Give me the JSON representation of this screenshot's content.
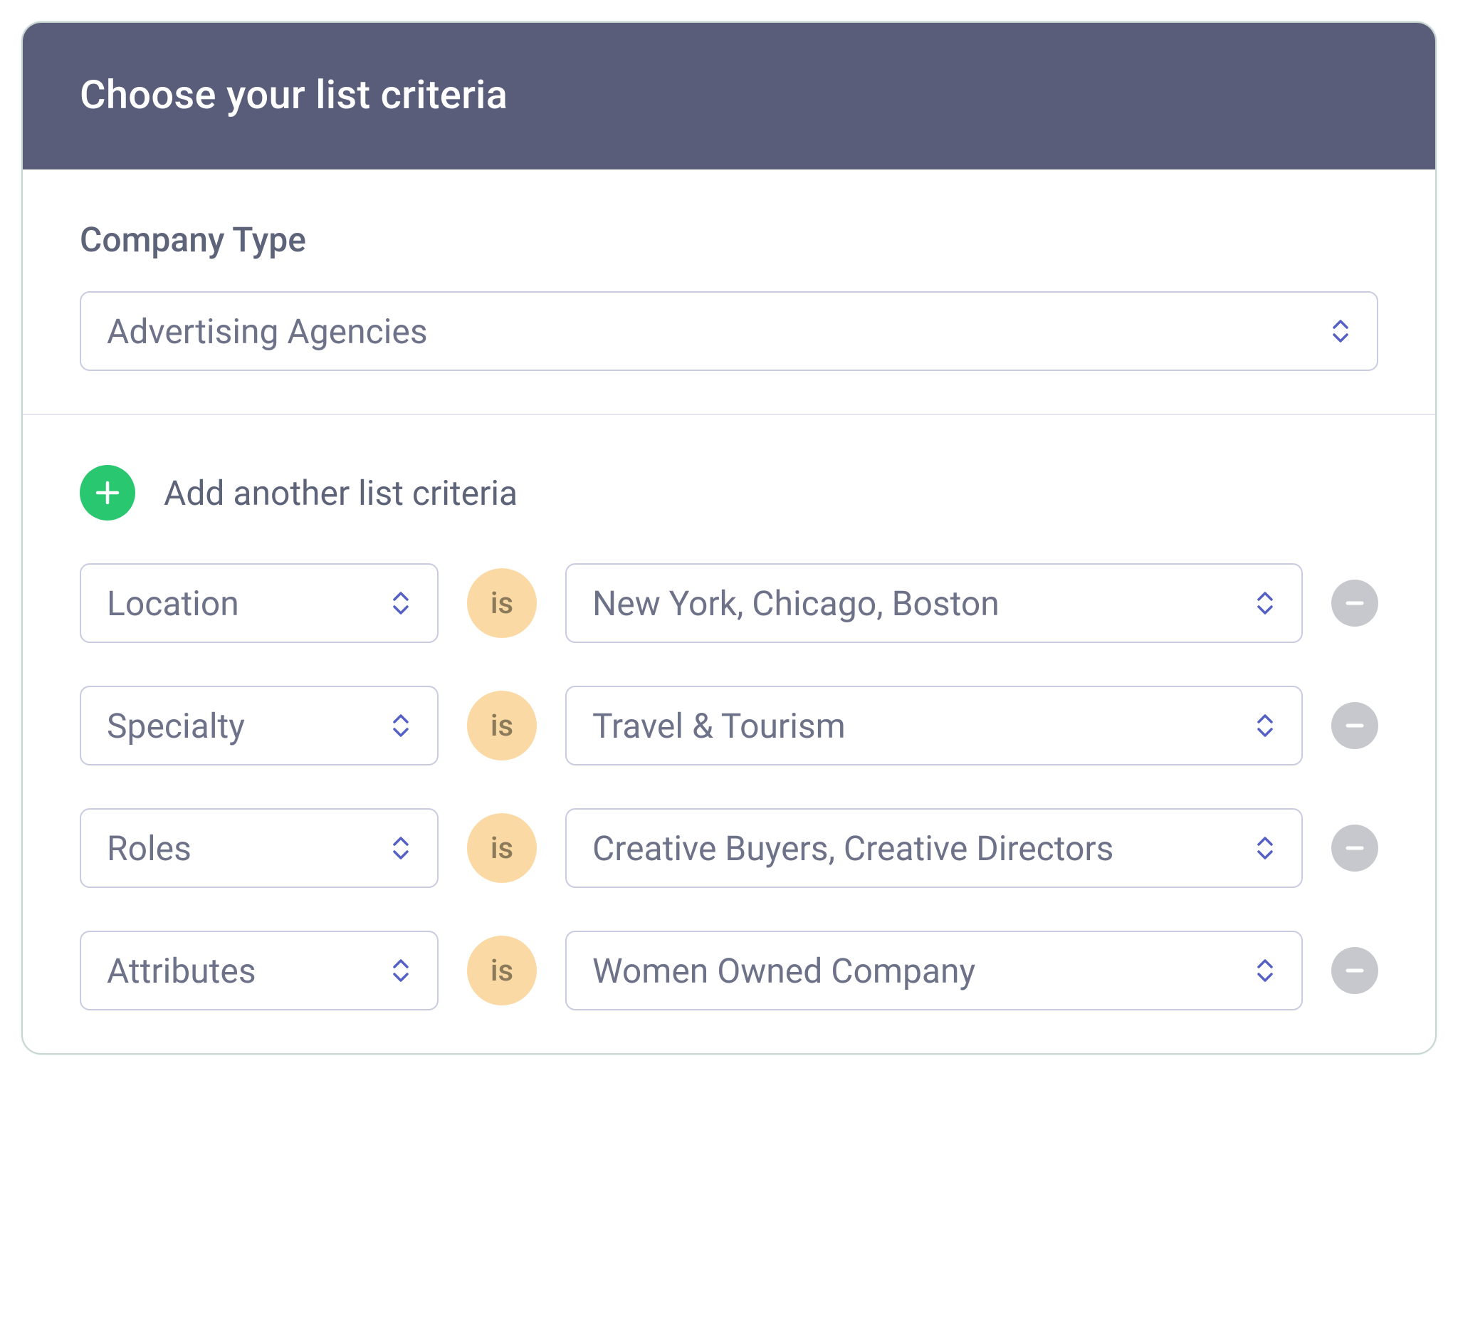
{
  "header": {
    "title": "Choose your list criteria"
  },
  "company_type": {
    "label": "Company Type",
    "value": "Advertising Agencies"
  },
  "add_criteria": {
    "label": "Add another list criteria"
  },
  "criteria": [
    {
      "field": "Location",
      "operator": "is",
      "value": "New York, Chicago, Boston"
    },
    {
      "field": "Specialty",
      "operator": "is",
      "value": "Travel & Tourism"
    },
    {
      "field": "Roles",
      "operator": "is",
      "value": "Creative Buyers, Creative Directors"
    },
    {
      "field": "Attributes",
      "operator": "is",
      "value": "Women Owned Company"
    }
  ]
}
